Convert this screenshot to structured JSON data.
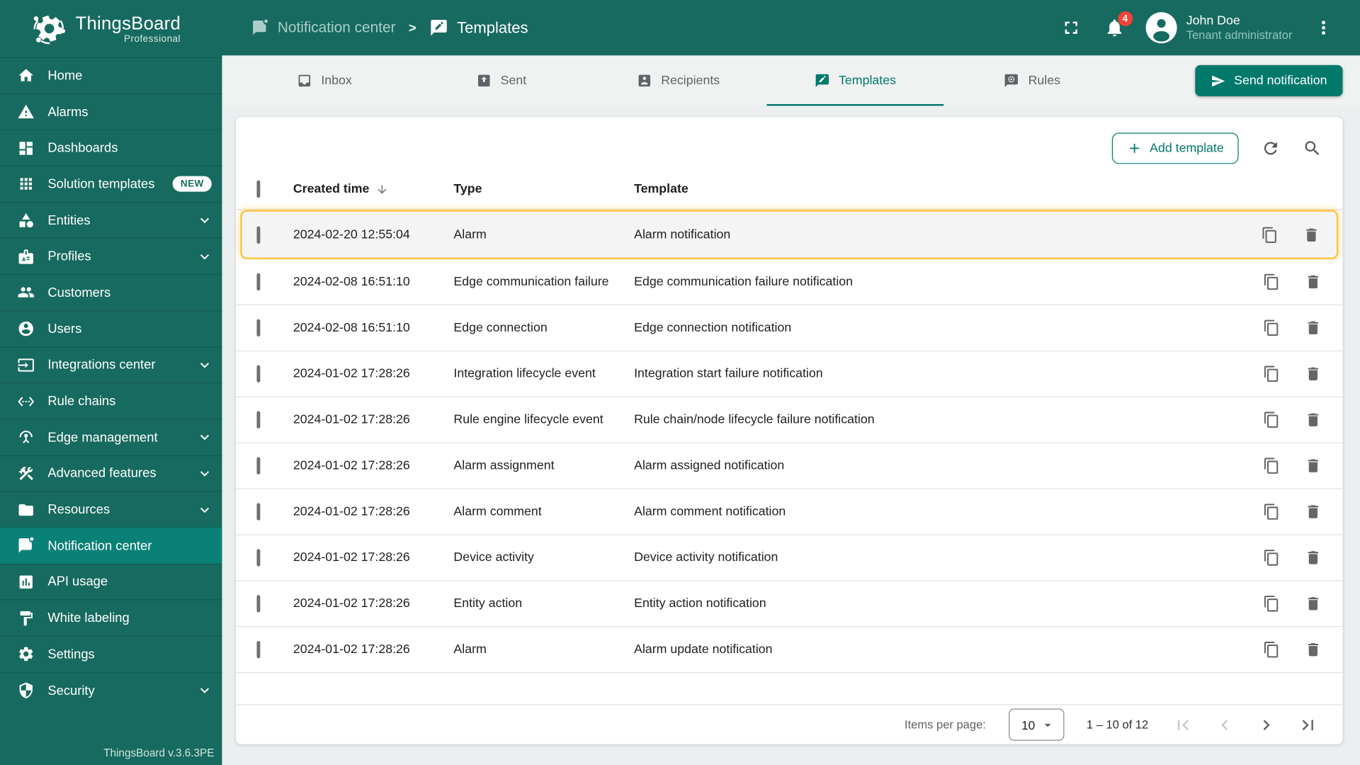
{
  "colors": {
    "primary": "#176a5f",
    "primary_active": "#0a8176",
    "accent": "#00796b",
    "highlight": "#fdc53d",
    "badge": "#f44336",
    "divider": "#e0e0e0",
    "text": "#212121",
    "tab_bar": "#f0f2f2",
    "page_bg": "#eceff0",
    "breadcrumb_muted": "#a9cec8"
  },
  "brand": {
    "name": "ThingsBoard",
    "edition": "Professional",
    "version": "ThingsBoard v.3.6.3PE"
  },
  "sidebar": {
    "items": [
      {
        "label": "Home",
        "icon": "home"
      },
      {
        "label": "Alarms",
        "icon": "alarms"
      },
      {
        "label": "Dashboards",
        "icon": "dashboards"
      },
      {
        "label": "Solution templates",
        "icon": "solution-templates",
        "badge": "NEW"
      },
      {
        "label": "Entities",
        "icon": "entities",
        "chevron": true
      },
      {
        "label": "Profiles",
        "icon": "profiles",
        "chevron": true
      },
      {
        "label": "Customers",
        "icon": "customers"
      },
      {
        "label": "Users",
        "icon": "users"
      },
      {
        "label": "Integrations center",
        "icon": "integrations",
        "chevron": true
      },
      {
        "label": "Rule chains",
        "icon": "rule-chains"
      },
      {
        "label": "Edge management",
        "icon": "edge",
        "chevron": true
      },
      {
        "label": "Advanced features",
        "icon": "advanced",
        "chevron": true
      },
      {
        "label": "Resources",
        "icon": "resources",
        "chevron": true
      },
      {
        "label": "Notification center",
        "icon": "notification",
        "active": true
      },
      {
        "label": "API usage",
        "icon": "api-usage"
      },
      {
        "label": "White labeling",
        "icon": "white-labeling"
      },
      {
        "label": "Settings",
        "icon": "settings"
      },
      {
        "label": "Security",
        "icon": "security",
        "chevron": true
      }
    ]
  },
  "header": {
    "breadcrumb_parent": "Notification center",
    "breadcrumb_separator": ">",
    "breadcrumb_current": "Templates",
    "notifications_badge": "4",
    "user_name": "John Doe",
    "user_role": "Tenant administrator"
  },
  "tabs": [
    {
      "label": "Inbox",
      "icon": "inbox"
    },
    {
      "label": "Sent",
      "icon": "sent"
    },
    {
      "label": "Recipients",
      "icon": "recipients"
    },
    {
      "label": "Templates",
      "icon": "templates",
      "active": true
    },
    {
      "label": "Rules",
      "icon": "rules"
    }
  ],
  "actions": {
    "send_notification": "Send notification",
    "add_template": "Add template"
  },
  "table": {
    "columns": [
      "Created time",
      "Type",
      "Template"
    ],
    "rows": [
      {
        "created": "2024-02-20 12:55:04",
        "type": "Alarm",
        "template": "Alarm notification",
        "highlighted": true
      },
      {
        "created": "2024-02-08 16:51:10",
        "type": "Edge communication failure",
        "template": "Edge communication failure notification"
      },
      {
        "created": "2024-02-08 16:51:10",
        "type": "Edge connection",
        "template": "Edge connection notification"
      },
      {
        "created": "2024-01-02 17:28:26",
        "type": "Integration lifecycle event",
        "template": "Integration start failure notification"
      },
      {
        "created": "2024-01-02 17:28:26",
        "type": "Rule engine lifecycle event",
        "template": "Rule chain/node lifecycle failure notification"
      },
      {
        "created": "2024-01-02 17:28:26",
        "type": "Alarm assignment",
        "template": "Alarm assigned notification"
      },
      {
        "created": "2024-01-02 17:28:26",
        "type": "Alarm comment",
        "template": "Alarm comment notification"
      },
      {
        "created": "2024-01-02 17:28:26",
        "type": "Device activity",
        "template": "Device activity notification"
      },
      {
        "created": "2024-01-02 17:28:26",
        "type": "Entity action",
        "template": "Entity action notification"
      },
      {
        "created": "2024-01-02 17:28:26",
        "type": "Alarm",
        "template": "Alarm update notification"
      }
    ]
  },
  "pagination": {
    "items_per_page_label": "Items per page:",
    "page_size": "10",
    "range_label": "1 – 10 of 12"
  }
}
